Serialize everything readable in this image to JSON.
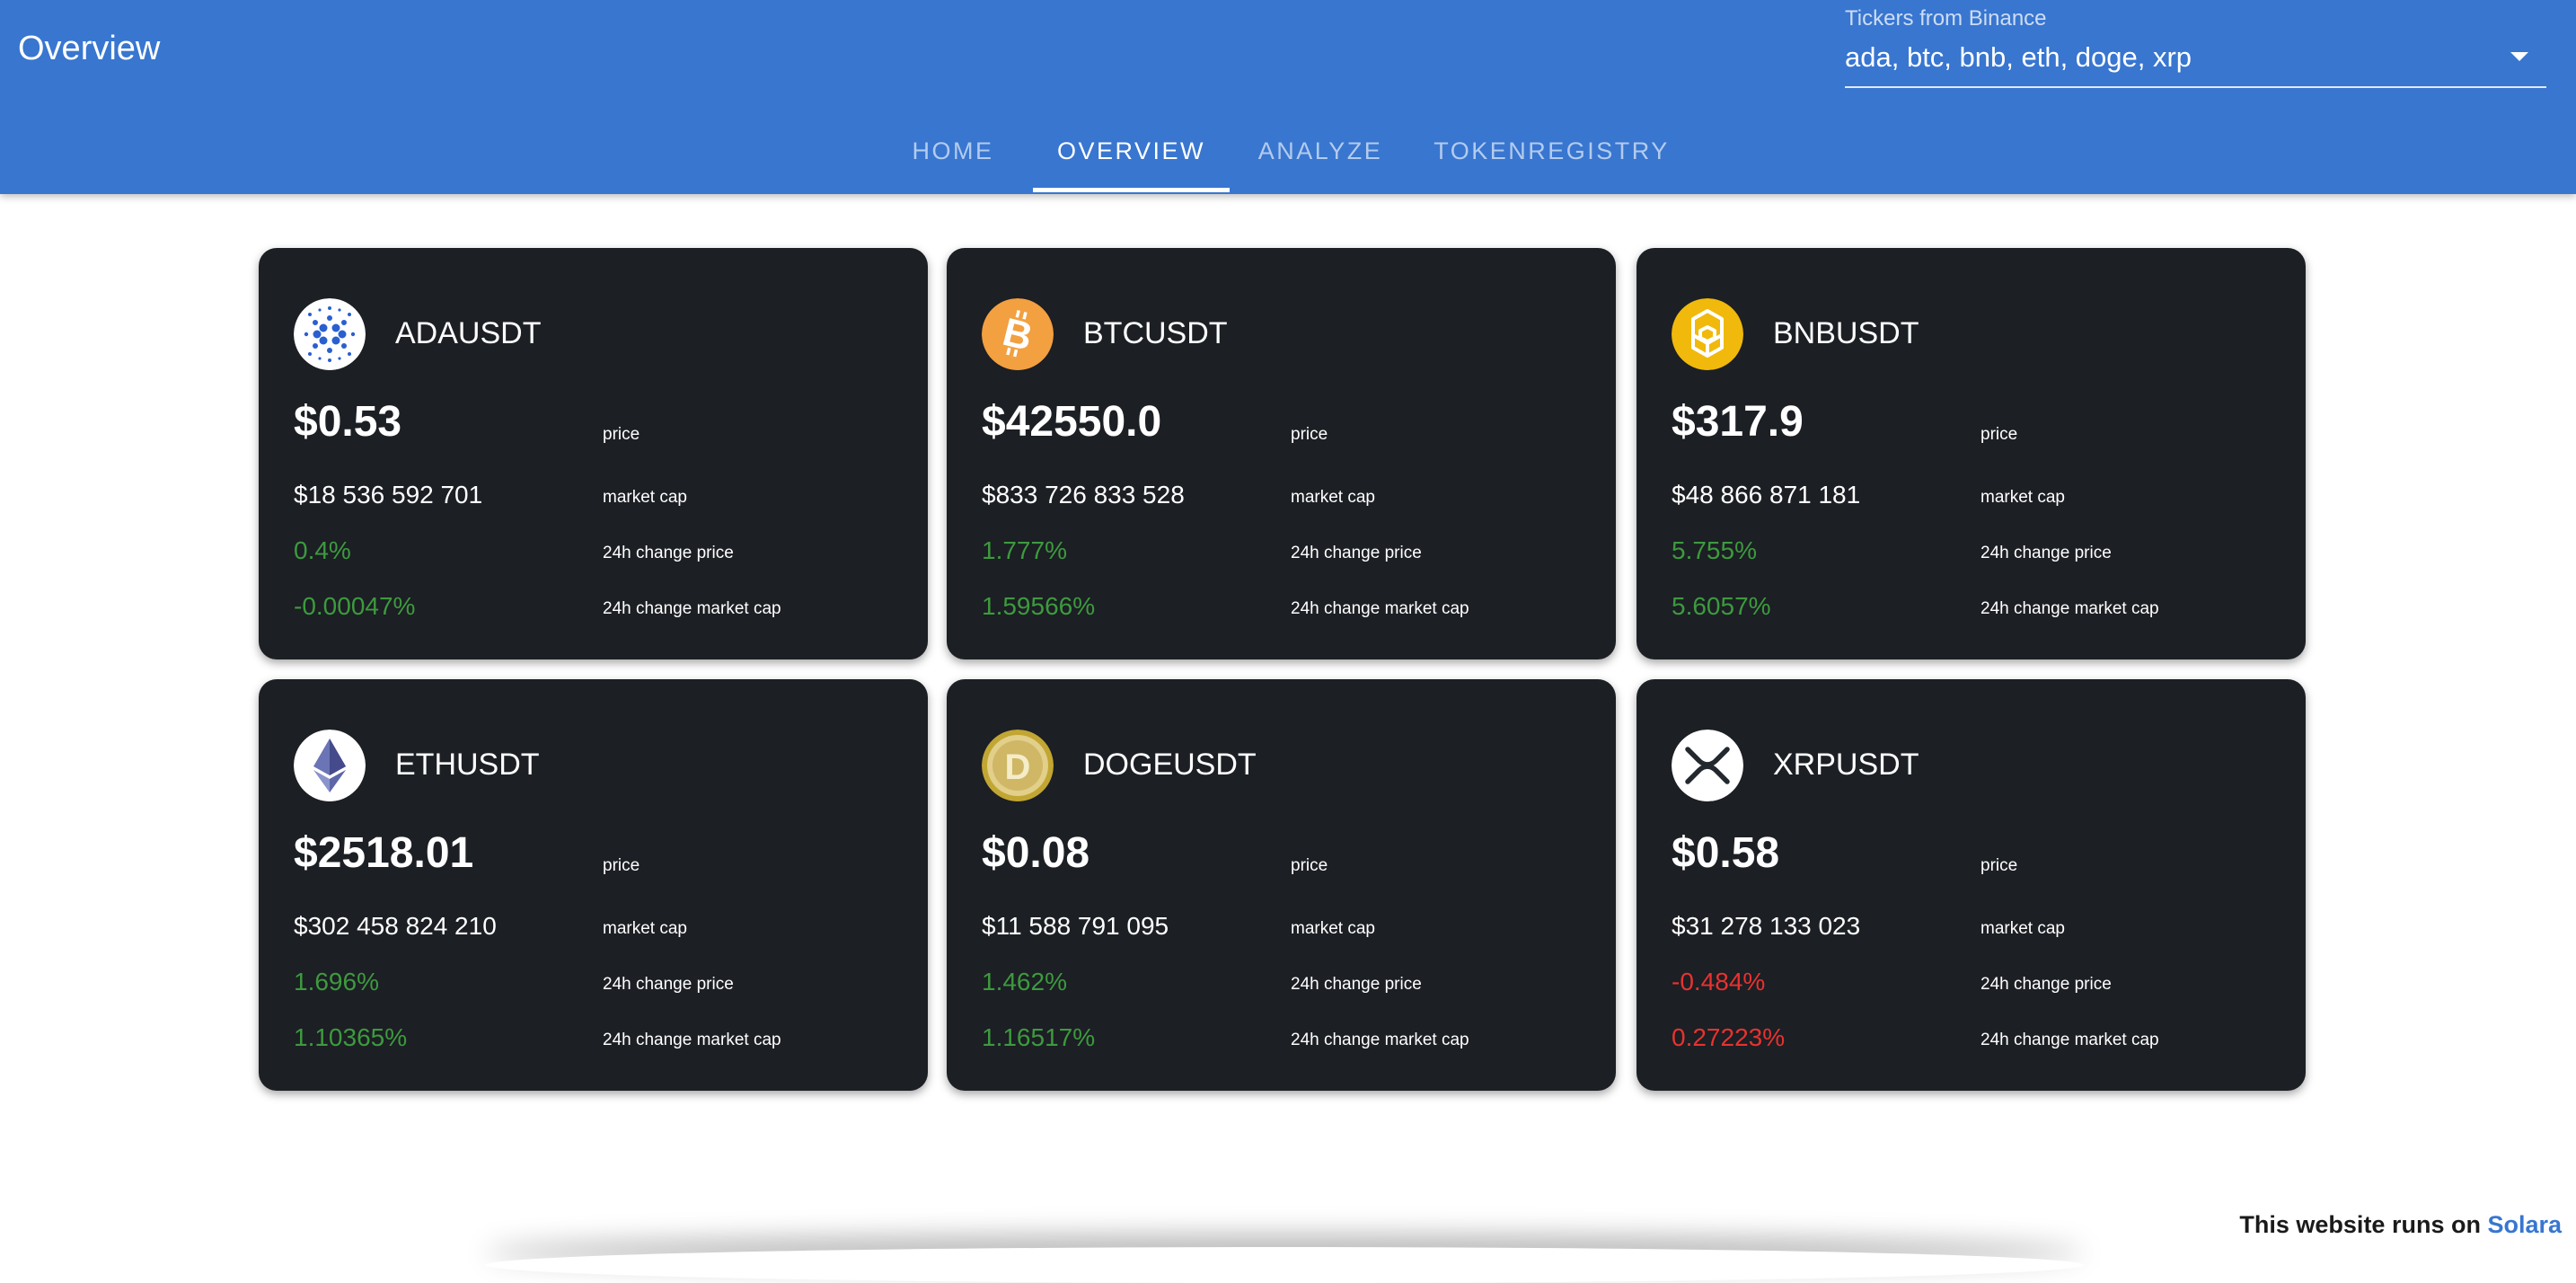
{
  "app": {
    "title": "Overview",
    "ticker_select": {
      "label": "Tickers from Binance",
      "value": "ada, btc, bnb, eth, doge, xrp"
    },
    "tabs": [
      {
        "label": "Home",
        "active": false
      },
      {
        "label": "Overview",
        "active": true
      },
      {
        "label": "Analyze",
        "active": false
      },
      {
        "label": "TokenRegistry",
        "active": false
      }
    ]
  },
  "labels": {
    "price": "price",
    "market_cap": "market cap",
    "change_price": "24h change price",
    "change_market_cap": "24h change market cap"
  },
  "cards": [
    {
      "symbol": "ADAUSDT",
      "icon": "cardano-icon",
      "price": "$0.53",
      "market_cap": "$18 536 592 701",
      "change_price": "0.4%",
      "change_market_cap": "-0.00047%",
      "price_trend": "positive",
      "cap_trend": "positive"
    },
    {
      "symbol": "BTCUSDT",
      "icon": "bitcoin-icon",
      "price": "$42550.0",
      "market_cap": "$833 726 833 528",
      "change_price": "1.777%",
      "change_market_cap": "1.59566%",
      "price_trend": "positive",
      "cap_trend": "positive"
    },
    {
      "symbol": "BNBUSDT",
      "icon": "bnb-icon",
      "price": "$317.9",
      "market_cap": "$48 866 871 181",
      "change_price": "5.755%",
      "change_market_cap": "5.6057%",
      "price_trend": "positive",
      "cap_trend": "positive"
    },
    {
      "symbol": "ETHUSDT",
      "icon": "ethereum-icon",
      "price": "$2518.01",
      "market_cap": "$302 458 824 210",
      "change_price": "1.696%",
      "change_market_cap": "1.10365%",
      "price_trend": "positive",
      "cap_trend": "positive"
    },
    {
      "symbol": "DOGEUSDT",
      "icon": "dogecoin-icon",
      "price": "$0.08",
      "market_cap": "$11 588 791 095",
      "change_price": "1.462%",
      "change_market_cap": "1.16517%",
      "price_trend": "positive",
      "cap_trend": "positive"
    },
    {
      "symbol": "XRPUSDT",
      "icon": "xrp-icon",
      "price": "$0.58",
      "market_cap": "$31 278 133 023",
      "change_price": "-0.484%",
      "change_market_cap": "0.27223%",
      "price_trend": "negative",
      "cap_trend": "negative"
    }
  ],
  "footer": {
    "text": "This website runs on ",
    "link": "Solara"
  },
  "colors": {
    "app_bar": "#3876d0",
    "card_bg": "#1c1f24",
    "positive": "#3d9a3e",
    "negative": "#e8322f"
  }
}
